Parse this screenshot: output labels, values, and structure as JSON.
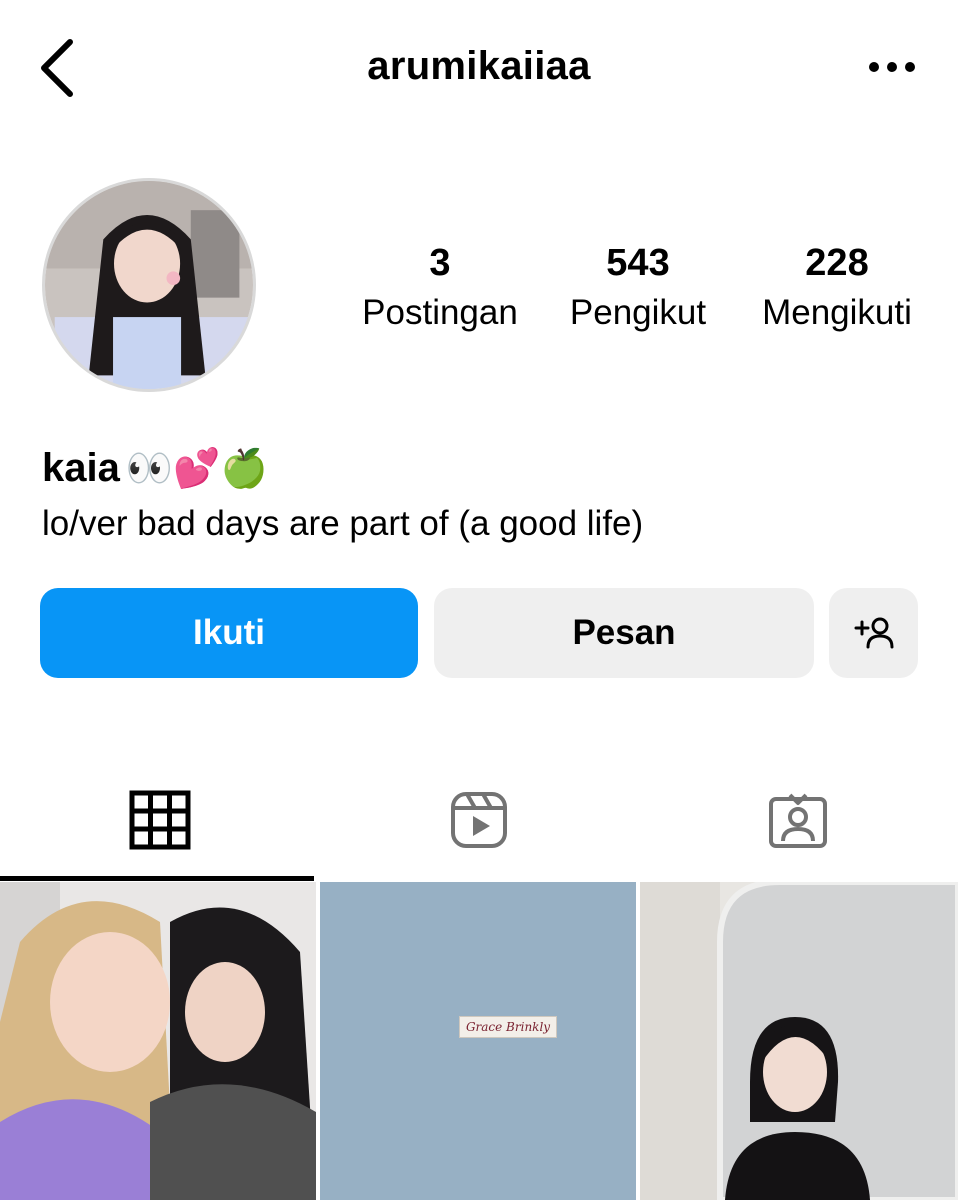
{
  "header": {
    "back_icon": "chevron-left-icon",
    "username": "arumikaiiaa",
    "more_icon": "more-horizontal-icon"
  },
  "profile": {
    "avatar_alt": "profile photo",
    "stats": [
      {
        "value": "3",
        "label": "Postingan"
      },
      {
        "value": "543",
        "label": "Pengikut"
      },
      {
        "value": "228",
        "label": "Mengikuti"
      }
    ],
    "display_name": "kaia",
    "display_name_emojis": "👀💕🍏",
    "bio": "lo/ver bad days are part of (a good life)"
  },
  "actions": {
    "follow_label": "Ikuti",
    "message_label": "Pesan",
    "suggest_icon": "add-person-icon"
  },
  "tabs": [
    {
      "icon": "grid-icon",
      "active": true
    },
    {
      "icon": "reels-icon",
      "active": false
    },
    {
      "icon": "tagged-icon",
      "active": false
    }
  ],
  "posts": [
    {
      "kind": "photo"
    },
    {
      "kind": "photo",
      "caption_on_image": "Grace Brinkly"
    },
    {
      "kind": "photo"
    }
  ],
  "colors": {
    "follow_button": "#0895f6",
    "secondary_button": "#efefef",
    "text": "#000000"
  }
}
